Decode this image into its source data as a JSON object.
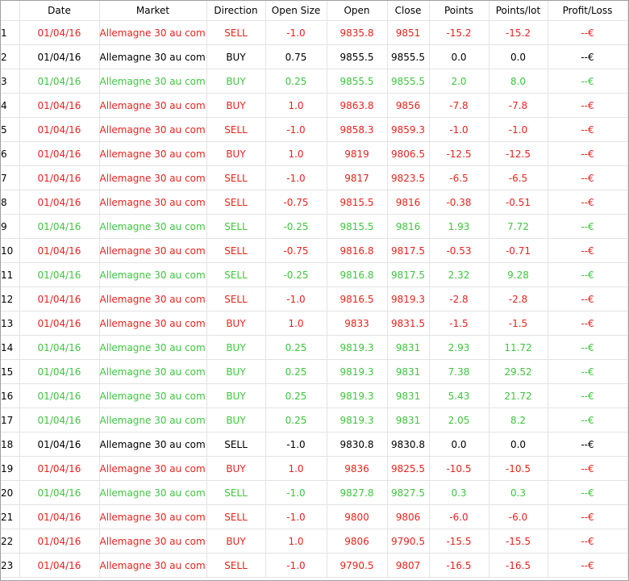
{
  "colors": {
    "loss": "#e8231d",
    "profit": "#3fc53f",
    "neutral": "#000000"
  },
  "columns": [
    "",
    "Date",
    "Market",
    "Direction",
    "Open Size",
    "Open",
    "Close",
    "Points",
    "Points/lot",
    "Profit/Loss"
  ],
  "rows": [
    {
      "idx": "1",
      "date": "01/04/16",
      "market": "Allemagne 30 au com...",
      "direction": "SELL",
      "open_size": "-1.0",
      "open": "9835.8",
      "close": "9851",
      "points": "-15.2",
      "points_lot": "-15.2",
      "pl": "--€",
      "tone": "red"
    },
    {
      "idx": "2",
      "date": "01/04/16",
      "market": "Allemagne 30 au com...",
      "direction": "BUY",
      "open_size": "0.75",
      "open": "9855.5",
      "close": "9855.5",
      "points": "0.0",
      "points_lot": "0.0",
      "pl": "--€",
      "tone": "black"
    },
    {
      "idx": "3",
      "date": "01/04/16",
      "market": "Allemagne 30 au com...",
      "direction": "BUY",
      "open_size": "0.25",
      "open": "9855.5",
      "close": "9855.5",
      "points": "2.0",
      "points_lot": "8.0",
      "pl": "--€",
      "tone": "green"
    },
    {
      "idx": "4",
      "date": "01/04/16",
      "market": "Allemagne 30 au com...",
      "direction": "BUY",
      "open_size": "1.0",
      "open": "9863.8",
      "close": "9856",
      "points": "-7.8",
      "points_lot": "-7.8",
      "pl": "--€",
      "tone": "red"
    },
    {
      "idx": "5",
      "date": "01/04/16",
      "market": "Allemagne 30 au com...",
      "direction": "SELL",
      "open_size": "-1.0",
      "open": "9858.3",
      "close": "9859.3",
      "points": "-1.0",
      "points_lot": "-1.0",
      "pl": "--€",
      "tone": "red"
    },
    {
      "idx": "6",
      "date": "01/04/16",
      "market": "Allemagne 30 au com...",
      "direction": "BUY",
      "open_size": "1.0",
      "open": "9819",
      "close": "9806.5",
      "points": "-12.5",
      "points_lot": "-12.5",
      "pl": "--€",
      "tone": "red"
    },
    {
      "idx": "7",
      "date": "01/04/16",
      "market": "Allemagne 30 au com...",
      "direction": "SELL",
      "open_size": "-1.0",
      "open": "9817",
      "close": "9823.5",
      "points": "-6.5",
      "points_lot": "-6.5",
      "pl": "--€",
      "tone": "red"
    },
    {
      "idx": "8",
      "date": "01/04/16",
      "market": "Allemagne 30 au com...",
      "direction": "SELL",
      "open_size": "-0.75",
      "open": "9815.5",
      "close": "9816",
      "points": "-0.38",
      "points_lot": "-0.51",
      "pl": "--€",
      "tone": "red"
    },
    {
      "idx": "9",
      "date": "01/04/16",
      "market": "Allemagne 30 au com...",
      "direction": "SELL",
      "open_size": "-0.25",
      "open": "9815.5",
      "close": "9816",
      "points": "1.93",
      "points_lot": "7.72",
      "pl": "--€",
      "tone": "green"
    },
    {
      "idx": "10",
      "date": "01/04/16",
      "market": "Allemagne 30 au com...",
      "direction": "SELL",
      "open_size": "-0.75",
      "open": "9816.8",
      "close": "9817.5",
      "points": "-0.53",
      "points_lot": "-0.71",
      "pl": "--€",
      "tone": "red"
    },
    {
      "idx": "11",
      "date": "01/04/16",
      "market": "Allemagne 30 au com...",
      "direction": "SELL",
      "open_size": "-0.25",
      "open": "9816.8",
      "close": "9817.5",
      "points": "2.32",
      "points_lot": "9.28",
      "pl": "--€",
      "tone": "green"
    },
    {
      "idx": "12",
      "date": "01/04/16",
      "market": "Allemagne 30 au com...",
      "direction": "SELL",
      "open_size": "-1.0",
      "open": "9816.5",
      "close": "9819.3",
      "points": "-2.8",
      "points_lot": "-2.8",
      "pl": "--€",
      "tone": "red"
    },
    {
      "idx": "13",
      "date": "01/04/16",
      "market": "Allemagne 30 au com...",
      "direction": "BUY",
      "open_size": "1.0",
      "open": "9833",
      "close": "9831.5",
      "points": "-1.5",
      "points_lot": "-1.5",
      "pl": "--€",
      "tone": "red"
    },
    {
      "idx": "14",
      "date": "01/04/16",
      "market": "Allemagne 30 au com...",
      "direction": "BUY",
      "open_size": "0.25",
      "open": "9819.3",
      "close": "9831",
      "points": "2.93",
      "points_lot": "11.72",
      "pl": "--€",
      "tone": "green"
    },
    {
      "idx": "15",
      "date": "01/04/16",
      "market": "Allemagne 30 au com...",
      "direction": "BUY",
      "open_size": "0.25",
      "open": "9819.3",
      "close": "9831",
      "points": "7.38",
      "points_lot": "29.52",
      "pl": "--€",
      "tone": "green"
    },
    {
      "idx": "16",
      "date": "01/04/16",
      "market": "Allemagne 30 au com...",
      "direction": "BUY",
      "open_size": "0.25",
      "open": "9819.3",
      "close": "9831",
      "points": "5.43",
      "points_lot": "21.72",
      "pl": "--€",
      "tone": "green"
    },
    {
      "idx": "17",
      "date": "01/04/16",
      "market": "Allemagne 30 au com...",
      "direction": "BUY",
      "open_size": "0.25",
      "open": "9819.3",
      "close": "9831",
      "points": "2.05",
      "points_lot": "8.2",
      "pl": "--€",
      "tone": "green"
    },
    {
      "idx": "18",
      "date": "01/04/16",
      "market": "Allemagne 30 au com...",
      "direction": "SELL",
      "open_size": "-1.0",
      "open": "9830.8",
      "close": "9830.8",
      "points": "0.0",
      "points_lot": "0.0",
      "pl": "--€",
      "tone": "black"
    },
    {
      "idx": "19",
      "date": "01/04/16",
      "market": "Allemagne 30 au com...",
      "direction": "BUY",
      "open_size": "1.0",
      "open": "9836",
      "close": "9825.5",
      "points": "-10.5",
      "points_lot": "-10.5",
      "pl": "--€",
      "tone": "red"
    },
    {
      "idx": "20",
      "date": "01/04/16",
      "market": "Allemagne 30 au com...",
      "direction": "SELL",
      "open_size": "-1.0",
      "open": "9827.8",
      "close": "9827.5",
      "points": "0.3",
      "points_lot": "0.3",
      "pl": "--€",
      "tone": "green"
    },
    {
      "idx": "21",
      "date": "01/04/16",
      "market": "Allemagne 30 au com...",
      "direction": "SELL",
      "open_size": "-1.0",
      "open": "9800",
      "close": "9806",
      "points": "-6.0",
      "points_lot": "-6.0",
      "pl": "--€",
      "tone": "red"
    },
    {
      "idx": "22",
      "date": "01/04/16",
      "market": "Allemagne 30 au com...",
      "direction": "BUY",
      "open_size": "1.0",
      "open": "9806",
      "close": "9790.5",
      "points": "-15.5",
      "points_lot": "-15.5",
      "pl": "--€",
      "tone": "red"
    },
    {
      "idx": "23",
      "date": "01/04/16",
      "market": "Allemagne 30 au com...",
      "direction": "SELL",
      "open_size": "-1.0",
      "open": "9790.5",
      "close": "9807",
      "points": "-16.5",
      "points_lot": "-16.5",
      "pl": "--€",
      "tone": "red"
    }
  ]
}
